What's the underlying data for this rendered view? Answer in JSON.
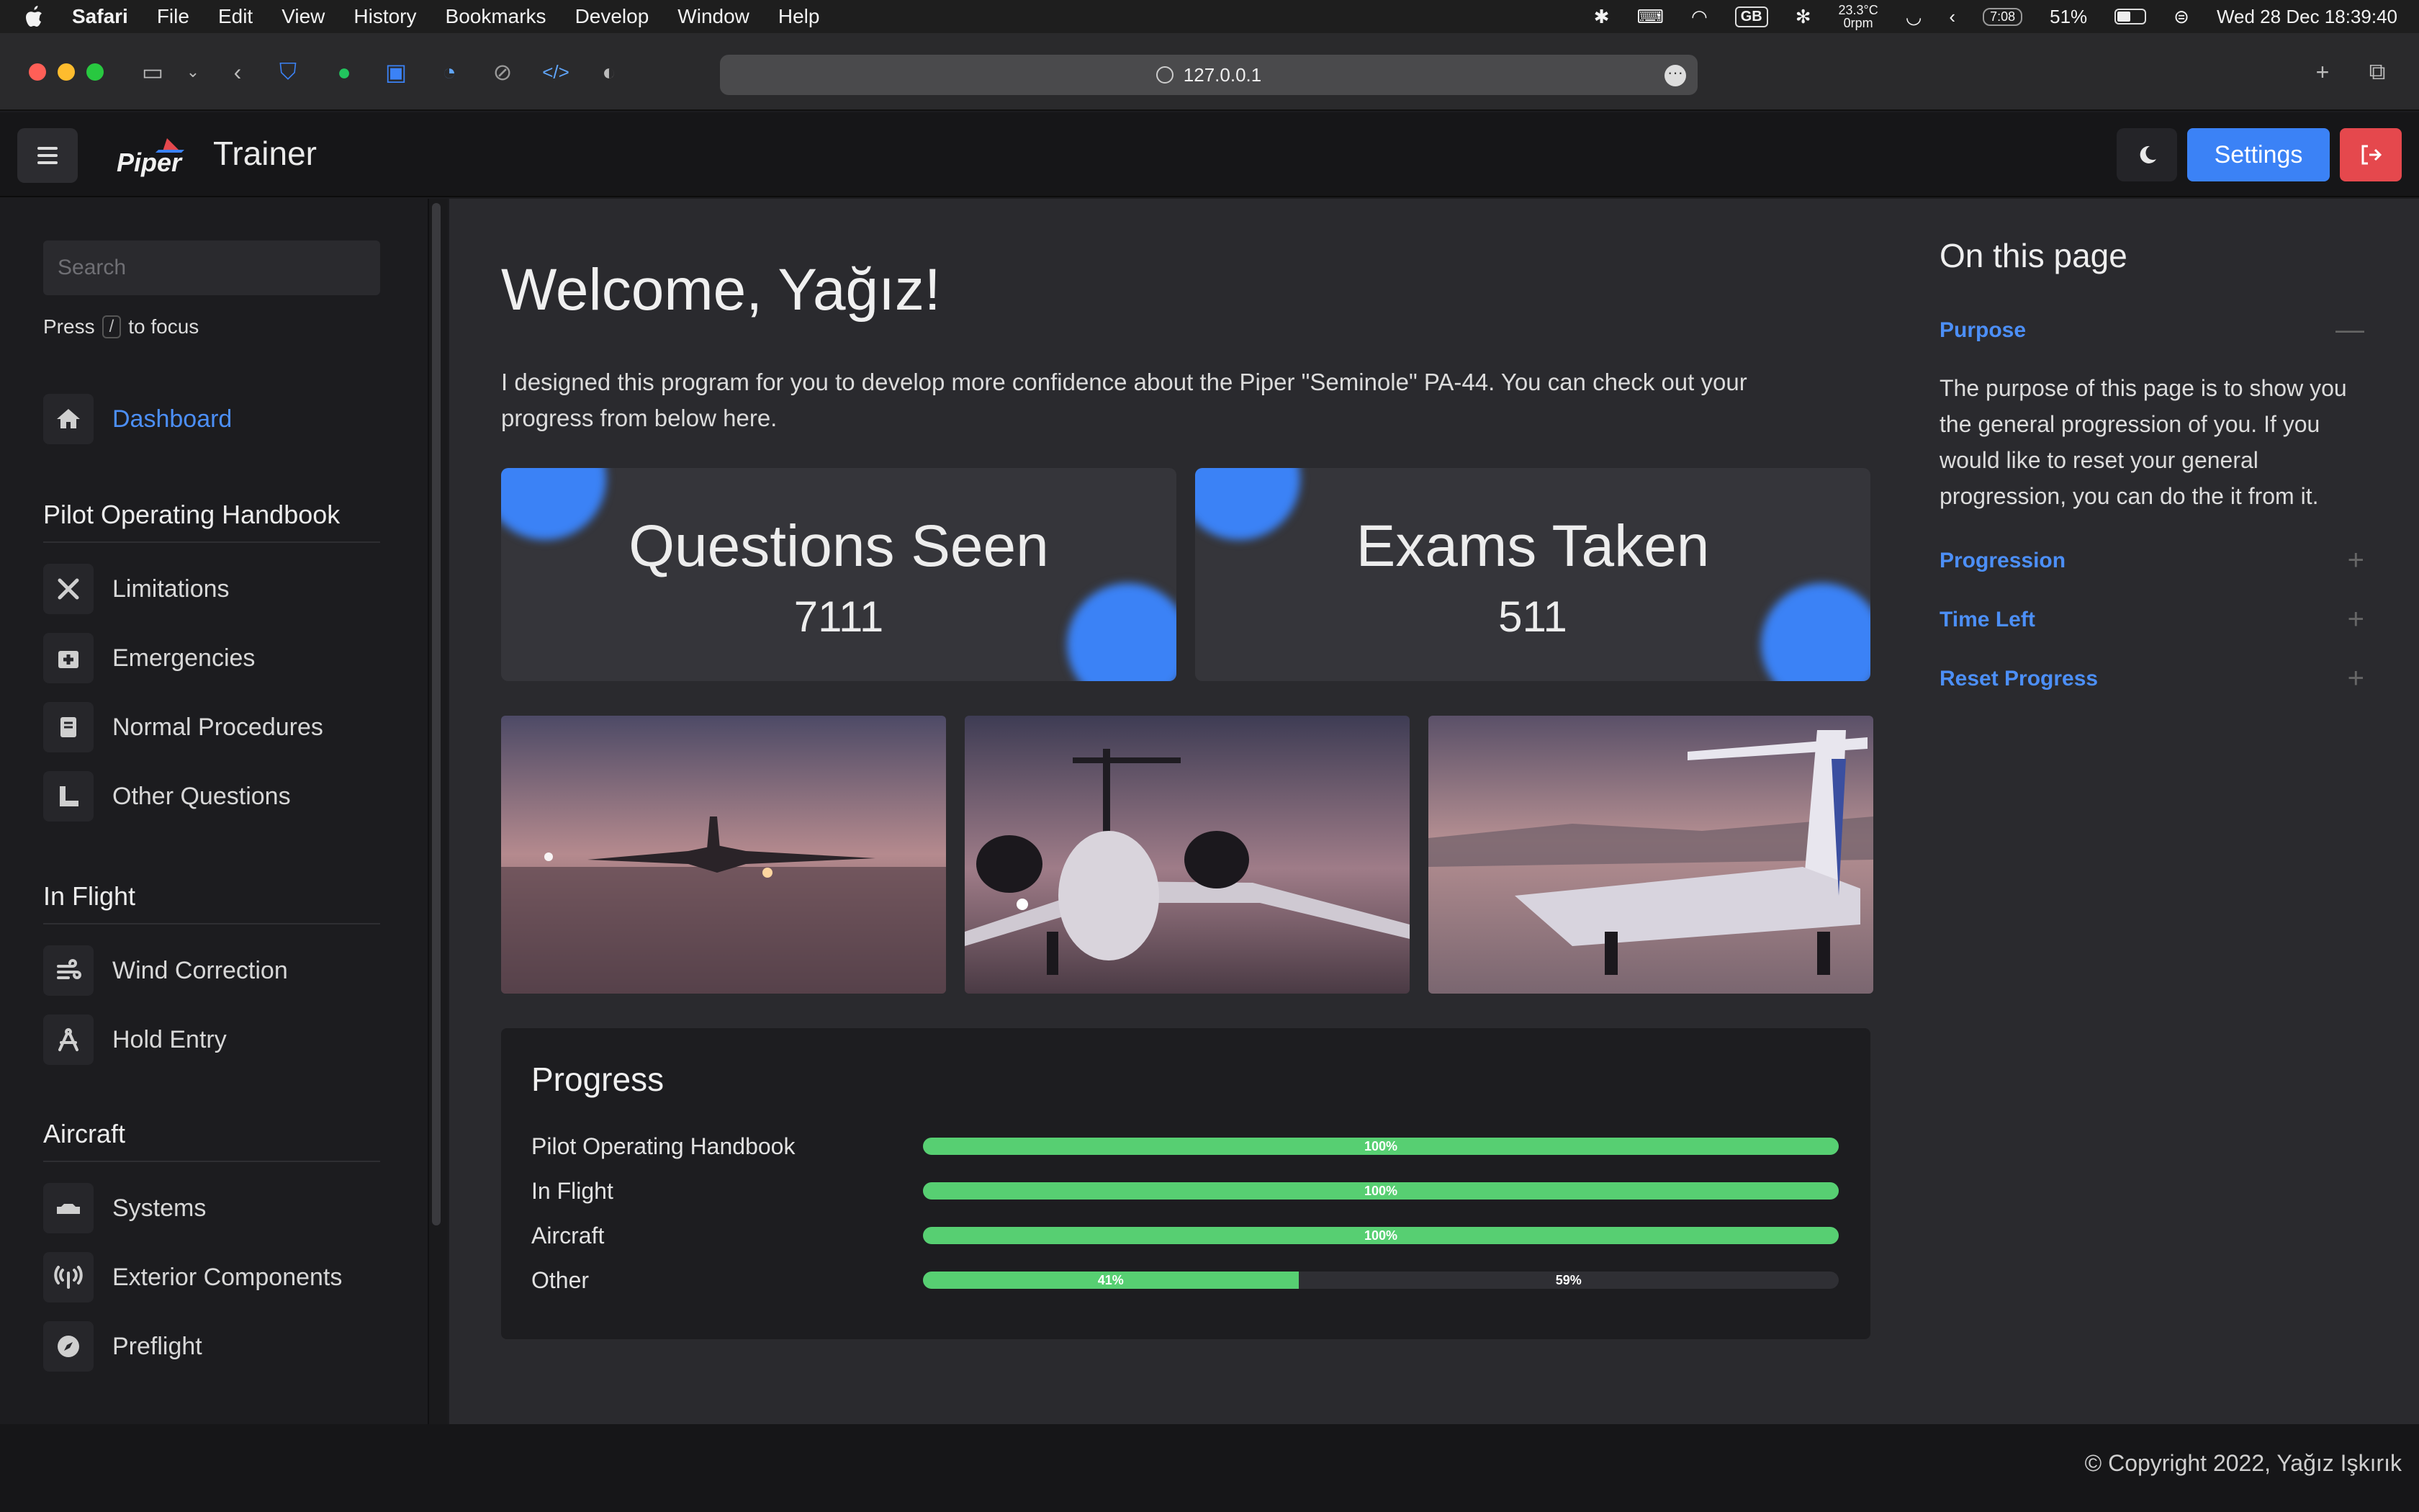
{
  "menubar": {
    "app": "Safari",
    "items": [
      "File",
      "Edit",
      "View",
      "History",
      "Bookmarks",
      "Develop",
      "Window",
      "Help"
    ],
    "keyboard": "GB",
    "fan_temp": "23.3°C",
    "fan_rpm": "0rpm",
    "time_remaining": "7:08",
    "battery": "51%",
    "datetime": "Wed 28 Dec  18:39:40"
  },
  "browser": {
    "url": "127.0.0.1"
  },
  "header": {
    "logo_text": "Piper",
    "brand": "Trainer",
    "settings_label": "Settings"
  },
  "sidebar": {
    "search_placeholder": "Search",
    "press": "Press",
    "press_key": "/",
    "press_suffix": "to focus",
    "dashboard": "Dashboard",
    "sections": [
      {
        "title": "Pilot Operating Handbook",
        "items": [
          "Limitations",
          "Emergencies",
          "Normal Procedures",
          "Other Questions"
        ]
      },
      {
        "title": "In Flight",
        "items": [
          "Wind Correction",
          "Hold Entry"
        ]
      },
      {
        "title": "Aircraft",
        "items": [
          "Systems",
          "Exterior Components",
          "Preflight"
        ]
      }
    ]
  },
  "main": {
    "welcome": "Welcome, Yağız!",
    "intro": "I designed this program for you to develop more confidence about the Piper \"Seminole\" PA-44. You can check out your progress from below here.",
    "stats": [
      {
        "label": "Questions Seen",
        "value": "7111"
      },
      {
        "label": "Exams Taken",
        "value": "511"
      }
    ],
    "progress": {
      "title": "Progress",
      "rows": [
        {
          "label": "Pilot Operating Handbook",
          "percent": 100,
          "done_label": "100%",
          "remaining_label": ""
        },
        {
          "label": "In Flight",
          "percent": 100,
          "done_label": "100%",
          "remaining_label": ""
        },
        {
          "label": "Aircraft",
          "percent": 100,
          "done_label": "100%",
          "remaining_label": ""
        },
        {
          "label": "Other",
          "percent": 41,
          "done_label": "41%",
          "remaining_label": "59%"
        }
      ]
    }
  },
  "on_this_page": {
    "title": "On this page",
    "items": [
      "Purpose",
      "Progression",
      "Time Left",
      "Reset Progress"
    ],
    "purpose_text": "The purpose of this page is to show you the general progression of you. If you would like to reset your general progression, you can do the it from it."
  },
  "footer": {
    "copyright": "© Copyright 2022, Yağız Işkırık"
  },
  "colors": {
    "accent": "#3b82f6",
    "danger": "#e5484d",
    "success": "#57cf72"
  }
}
